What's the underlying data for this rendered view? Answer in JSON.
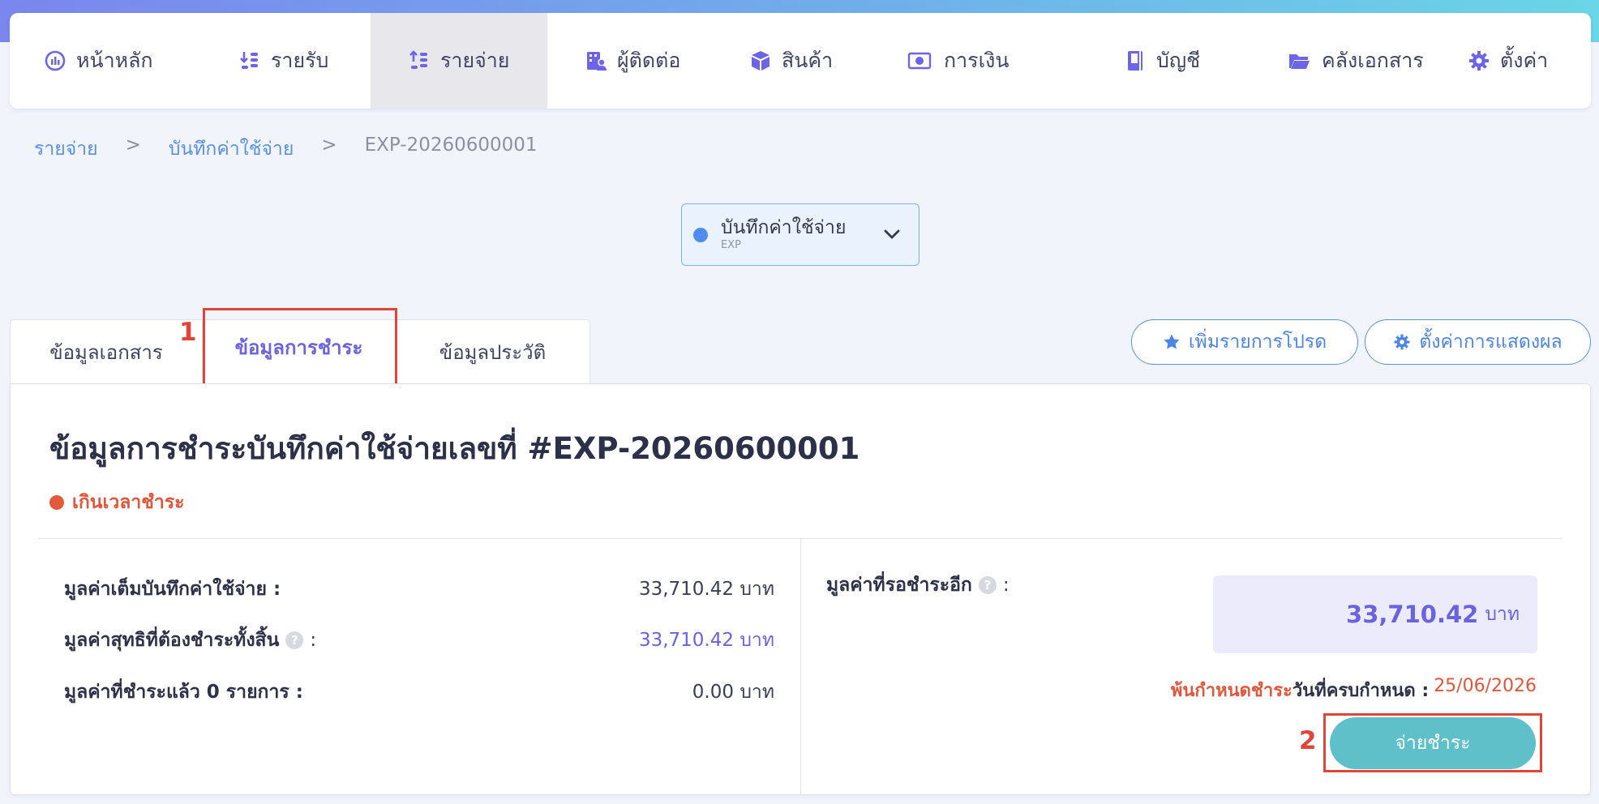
{
  "nav": {
    "items": [
      {
        "label": "หน้าหลัก",
        "icon": "dashboard-icon"
      },
      {
        "label": "รายรับ",
        "icon": "income-icon"
      },
      {
        "label": "รายจ่าย",
        "icon": "expense-icon"
      },
      {
        "label": "ผู้ติดต่อ",
        "icon": "contacts-icon"
      },
      {
        "label": "สินค้า",
        "icon": "box-icon"
      },
      {
        "label": "การเงิน",
        "icon": "money-icon"
      },
      {
        "label": "บัญชี",
        "icon": "book-icon"
      },
      {
        "label": "คลังเอกสาร",
        "icon": "folder-icon"
      },
      {
        "label": "ตั้งค่า",
        "icon": "gear-icon"
      }
    ],
    "active_index": 2
  },
  "breadcrumb": {
    "level1": "รายจ่าย",
    "sep1": ">",
    "level2": "บันทึกค่าใช้จ่าย",
    "sep2": ">",
    "current": "EXP-20260600001"
  },
  "doc_type_select": {
    "label": "บันทึกค่าใช้จ่าย",
    "code": "EXP"
  },
  "tabs": [
    {
      "label": "ข้อมูลเอกสาร"
    },
    {
      "label": "ข้อมูลการชำระ",
      "active": true
    },
    {
      "label": "ข้อมูลประวัติ"
    }
  ],
  "annotations": {
    "marker1": "1",
    "marker2": "2"
  },
  "actions": {
    "favorite": "เพิ่มรายการโปรด",
    "display_settings": "ตั้งค่าการแสดงผล"
  },
  "payment": {
    "title": "ข้อมูลการชำระบันทึกค่าใช้จ่ายเลขที่ #EXP-20260600001",
    "status": "เกินเวลาชำระ",
    "rows": [
      {
        "label": "มูลค่าเต็มบันทึกค่าใช้จ่าย :",
        "value": "33,710.42 บาท"
      },
      {
        "label": "มูลค่าสุทธิที่ต้องชำระทั้งสิ้น",
        "colon": ":",
        "value": "33,710.42 บาท"
      },
      {
        "label": "มูลค่าที่ชำระแล้ว 0 รายการ :",
        "value": "0.00 บาท"
      }
    ],
    "help_glyph": "?",
    "remaining_label": "มูลค่าที่รอชำระอีก",
    "remaining_colon": ":",
    "remaining_amount": "33,710.42",
    "remaining_unit": "บาท",
    "overdue_text": "พ้นกำหนดชำระ",
    "due_label": "วันที่ครบกำหนด :",
    "due_date": "25/06/2026",
    "pay_button": "จ่ายชำระ"
  },
  "colors": {
    "accent": "#6a62de",
    "link": "#5a8fe6",
    "overdue": "#e2573b",
    "pay_button": "#5fc0ca",
    "annotation": "#e0453a"
  }
}
